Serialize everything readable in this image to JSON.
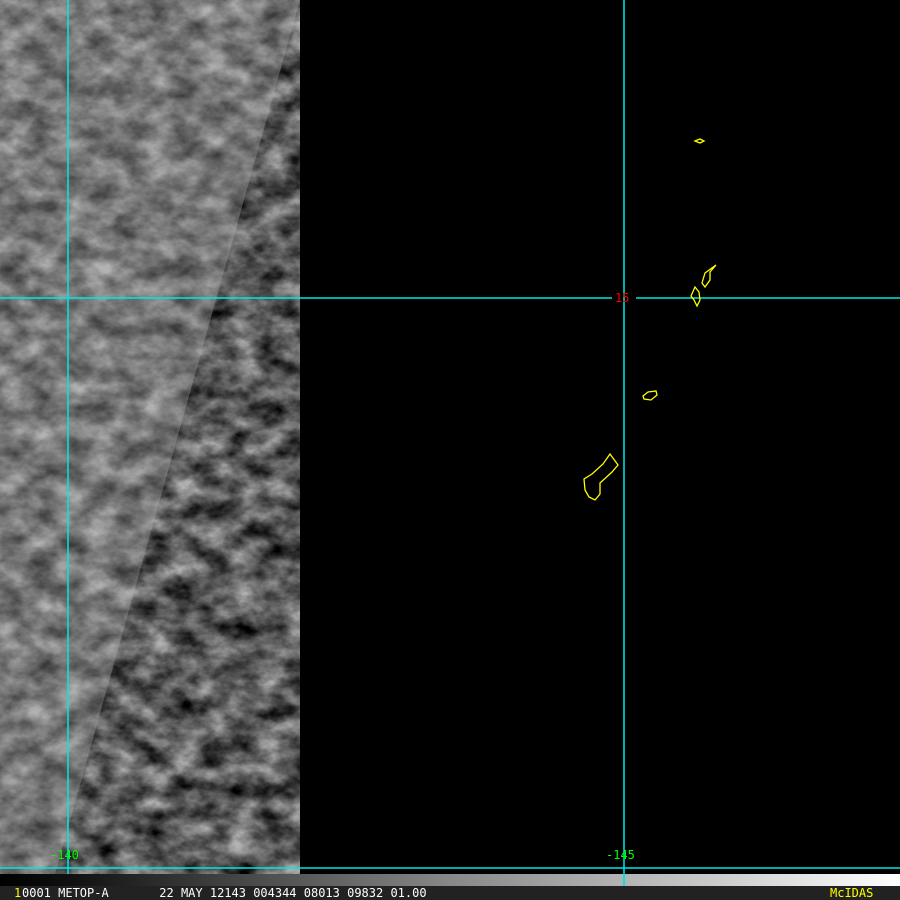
{
  "map": {
    "latitude_label": "15",
    "longitude_labels": [
      "-140",
      "-145"
    ],
    "colors": {
      "grid": "#00e5e5",
      "coast": "#ffff00",
      "lat_label": "#ff0000",
      "lon_label": "#00ff00"
    }
  },
  "status_bar": {
    "frame_number": "1",
    "info": "0001 METOP-A       22 MAY 12143 004344 08013 09832 01.00",
    "brand": "McIDAS"
  }
}
